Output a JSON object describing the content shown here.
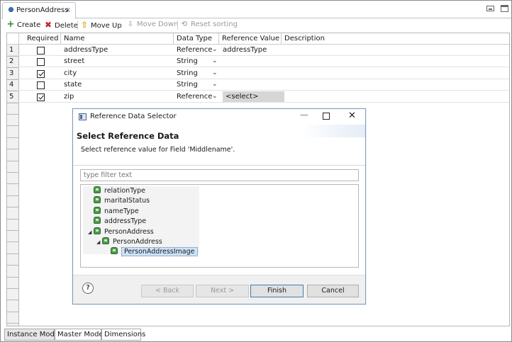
{
  "editor": {
    "tab_title": "PersonAddress",
    "tab_close": "×"
  },
  "toolbar": {
    "create": "Create",
    "delete": "Delete",
    "move_up": "Move Up",
    "move_down": "Move Down",
    "reset_sorting": "Reset sorting",
    "icons": {
      "create": "+",
      "delete": "✖",
      "move_up": "⇧",
      "move_down": "⇩",
      "reset_sorting": "⟲"
    }
  },
  "table": {
    "columns": [
      "Required",
      "Name",
      "Data Type",
      "Reference Value",
      "Description"
    ],
    "dropdown_glyph": "⌄",
    "rows": [
      {
        "num": "1",
        "required": false,
        "name": "addressType",
        "data_type": "Reference",
        "reference_value": "addressType"
      },
      {
        "num": "2",
        "required": false,
        "name": "street",
        "data_type": "String",
        "reference_value": ""
      },
      {
        "num": "3",
        "required": true,
        "name": "city",
        "data_type": "String",
        "reference_value": ""
      },
      {
        "num": "4",
        "required": false,
        "name": "state",
        "data_type": "String",
        "reference_value": ""
      },
      {
        "num": "5",
        "required": true,
        "name": "zip",
        "data_type": "Reference",
        "reference_value": "<select>"
      }
    ]
  },
  "bottom_tabs": [
    "Instance Model",
    "Master Model",
    "Dimensions"
  ],
  "dialog": {
    "title": "Reference Data Selector",
    "heading": "Select Reference Data",
    "subtitle": "Select reference value for Field 'Middlename'.",
    "filter_placeholder": "type filter text",
    "controls": {
      "minimize": "—",
      "close": "✕"
    },
    "tree": [
      {
        "label": "relationType",
        "depth": 0,
        "expander": ""
      },
      {
        "label": "maritalStatus",
        "depth": 0,
        "expander": ""
      },
      {
        "label": "nameType",
        "depth": 0,
        "expander": ""
      },
      {
        "label": "addressType",
        "depth": 0,
        "expander": ""
      },
      {
        "label": "PersonAddress",
        "depth": 0,
        "expander": "◢"
      },
      {
        "label": "PersonAddress",
        "depth": 1,
        "expander": "◢"
      },
      {
        "label": "PersonAddressImage",
        "depth": 2,
        "expander": "",
        "selected": true
      }
    ],
    "buttons": {
      "help": "?",
      "back": "< Back",
      "next": "Next >",
      "finish": "Finish",
      "cancel": "Cancel"
    }
  }
}
